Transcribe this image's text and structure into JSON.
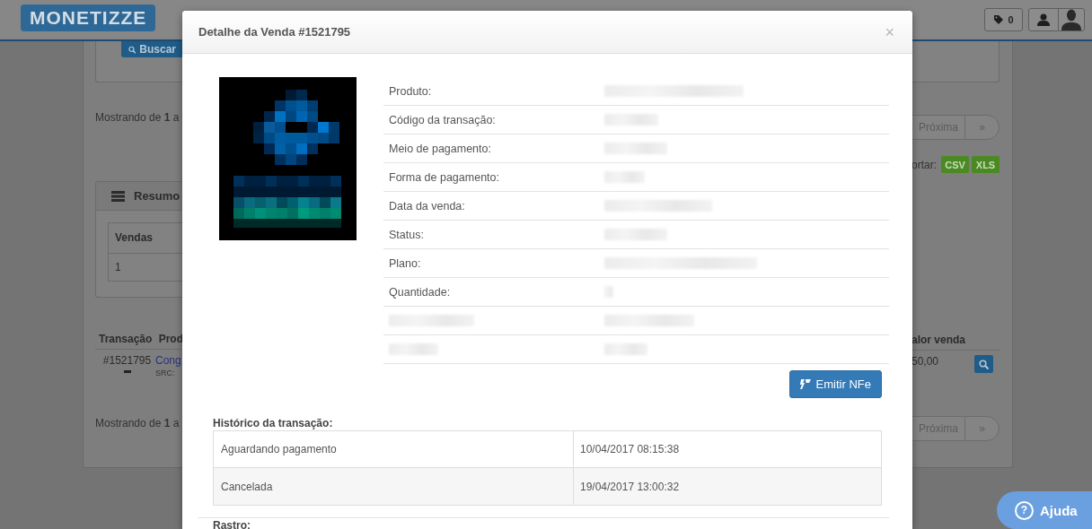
{
  "header": {
    "logo": "MONETIZZE",
    "tags_count": "0"
  },
  "background": {
    "search_button": "Buscar",
    "showing_top": "Mostrando de **1** a",
    "pagination_top": [
      "Próxima",
      "»"
    ],
    "export_label": "ortar:",
    "export_buttons": [
      "CSV",
      "XLS"
    ],
    "summary": {
      "title": "Resumo",
      "column": "Vendas",
      "value": "1"
    },
    "sales_table": {
      "columns": [
        "Transação",
        "Prod",
        "alor venda"
      ],
      "rows": [
        {
          "transaction": "#1521795",
          "product": "Cong",
          "source": "SRC:",
          "value": "50,00"
        }
      ]
    },
    "showing_bottom": "Mostrando de **1** a",
    "pagination_bottom": [
      "Próxima",
      "»"
    ]
  },
  "modal": {
    "title": "Detalhe da Venda #1521795",
    "close": "×",
    "details": [
      {
        "kind": "labeled",
        "label": "Produto:"
      },
      {
        "kind": "labeled",
        "label": "Código da transação:"
      },
      {
        "kind": "labeled",
        "label": "Meio de pagamento:"
      },
      {
        "kind": "labeled",
        "label": "Forma de pagamento:"
      },
      {
        "kind": "labeled",
        "label": "Data da venda:"
      },
      {
        "kind": "labeled",
        "label": "Status:"
      },
      {
        "kind": "labeled",
        "label": "Plano:"
      },
      {
        "kind": "labeled",
        "label": "Quantidade:"
      },
      {
        "kind": "redacted"
      },
      {
        "kind": "redacted"
      }
    ],
    "action_button": "Emitir NFe",
    "history": {
      "title": "Histórico da transação:",
      "rows": [
        {
          "status": "Aguardando pagamento",
          "date": "10/04/2017 08:15:38"
        },
        {
          "status": "Cancelada",
          "date": "19/04/2017 13:00:32"
        }
      ]
    },
    "trail_title": "Rastro:"
  },
  "help_button": {
    "icon": "?",
    "label": "Ajuda"
  }
}
